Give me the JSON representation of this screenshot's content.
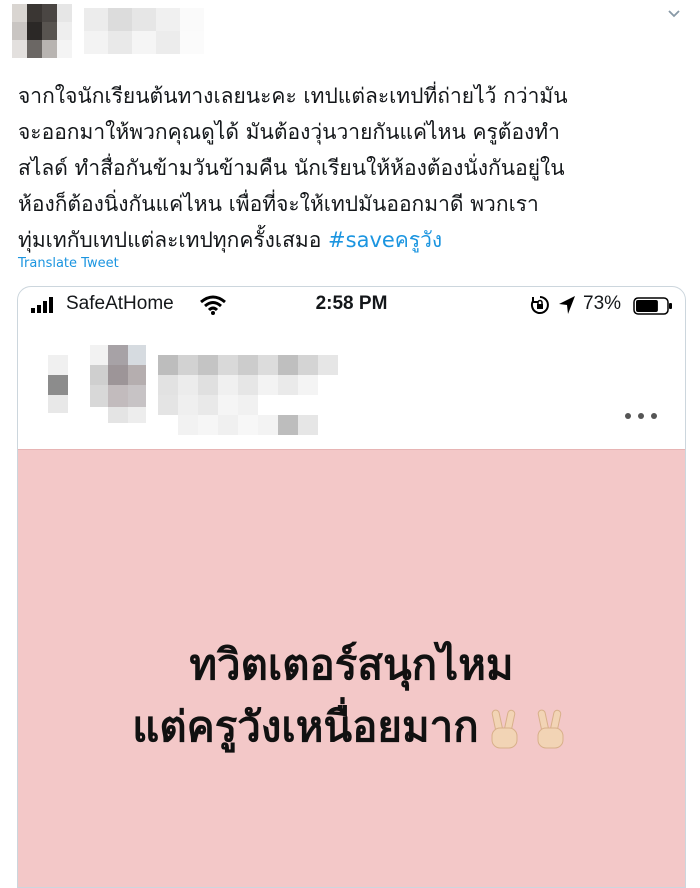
{
  "tweet": {
    "text_lines": [
      "จากใจนักเรียนต้นทางเลยนะคะ เทปแต่ละเทปที่ถ่ายไว้ กว่ามัน",
      "จะออกมาให้พวกคุณดูได้ มันต้องวุ่นวายกันแค่ไหน ครูต้องทำ",
      "สไลด์ ทำสื่อกันข้ามวันข้ามคืน นักเรียนให้ห้องต้องนั่งกันอยู่ใน",
      "ห้องก็ต้องนิ่งกันแค่ไหน เพื่อที่จะให้เทปมันออกมาดี พวกเรา",
      "ทุ่มเทกับเทปแต่ละเทปทุกครั้งเสมอ "
    ],
    "hashtag": "#saveครูวัง",
    "translate_label": "Translate Tweet"
  },
  "phone": {
    "carrier": "SafeAtHome",
    "time": "2:58 PM",
    "battery_percent": "73%",
    "battery_level": 0.73
  },
  "post": {
    "line1": "ทวิตเตอร์สนุกไหม",
    "line2": "แต่ครูวังเหนื่อยมาก",
    "background": "#f3c8c8"
  },
  "colors": {
    "link": "#1b95e0",
    "text": "#14171a"
  },
  "icons": [
    "chevron-down-icon",
    "signal-icon",
    "wifi-icon",
    "rotation-lock-icon",
    "location-arrow-icon",
    "battery-icon",
    "more-dots-icon",
    "victory-hand-emoji"
  ]
}
